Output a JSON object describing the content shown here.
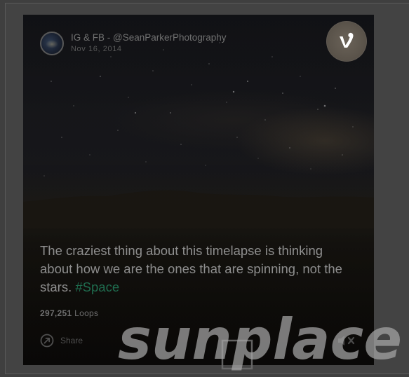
{
  "post": {
    "username": "IG & FB - @SeanParkerPhotography",
    "date": "Nov 16, 2014",
    "caption_text": "The craziest thing about this timelapse is thinking about how we are the ones that are spinning, not the stars. ",
    "hashtag": "#Space",
    "loops_count": "297,251",
    "loops_label": "Loops",
    "share_label": "Share"
  },
  "watermark": {
    "text": "sunplace"
  },
  "icons": {
    "vine": "vine-logo-icon",
    "share": "share-arrow-icon",
    "mute": "speaker-muted-icon"
  },
  "colors": {
    "caption": "#8e8e8e",
    "hashtag": "#1f6d4f",
    "vine_badge": "#5b544b"
  }
}
